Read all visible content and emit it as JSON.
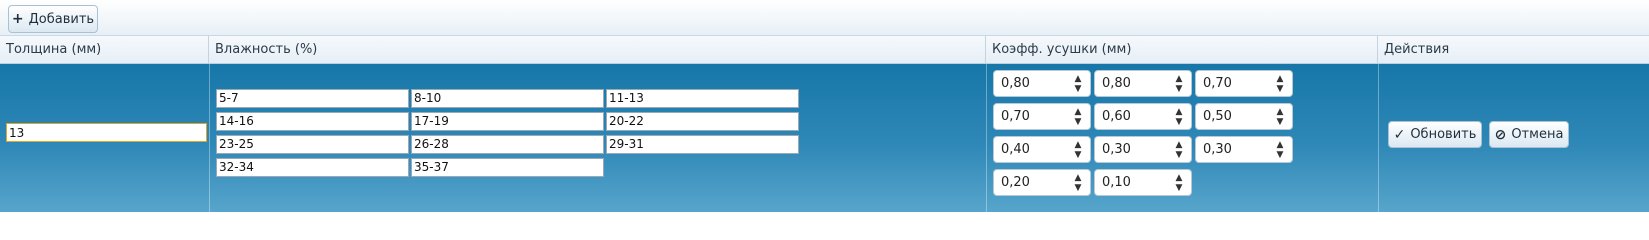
{
  "toolbar": {
    "add_icon": "+",
    "add_label": "Добавить"
  },
  "columns": {
    "thickness": "Толщина (мм)",
    "humidity": "Влажность (%)",
    "coeff": "Коэфф. усушки (мм)",
    "actions": "Действия"
  },
  "row": {
    "thickness_value": "13",
    "humidity_ranges": [
      [
        "5-7",
        "8-10",
        "11-13"
      ],
      [
        "14-16",
        "17-19",
        "20-22"
      ],
      [
        "23-25",
        "26-28",
        "29-31"
      ],
      [
        "32-34",
        "35-37"
      ]
    ],
    "coefficients": [
      [
        "0,80",
        "0,80",
        "0,70"
      ],
      [
        "0,70",
        "0,60",
        "0,50"
      ],
      [
        "0,40",
        "0,30",
        "0,30"
      ],
      [
        "0,20",
        "0,10"
      ]
    ],
    "update_icon": "✓",
    "update_label": "Обновить",
    "cancel_icon": "⊘",
    "cancel_label": "Отмена"
  }
}
